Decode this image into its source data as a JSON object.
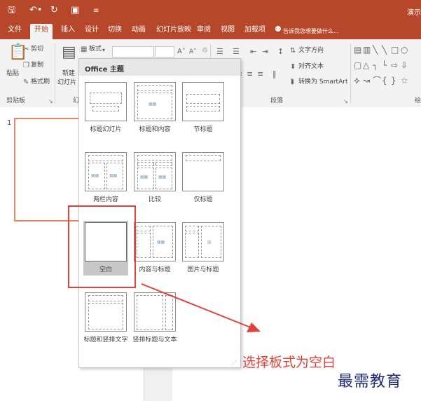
{
  "titlebar": {
    "save_icon": "save-icon",
    "undo_icon": "undo-icon",
    "redo_icon": "redo-icon",
    "start_icon": "start-from-beginning-icon",
    "customize_icon": "customize-toolbar-icon",
    "title_text": "演示"
  },
  "tabs": [
    {
      "label": "文件"
    },
    {
      "label": "开始"
    },
    {
      "label": "插入"
    },
    {
      "label": "设计"
    },
    {
      "label": "切换"
    },
    {
      "label": "动画"
    },
    {
      "label": "幻灯片放映"
    },
    {
      "label": "审阅"
    },
    {
      "label": "视图"
    },
    {
      "label": "加载项"
    }
  ],
  "tellme": "告诉我您想要做什么...",
  "ribbon": {
    "paste": "粘贴",
    "cut": "剪切",
    "copy": "复制",
    "format_painter": "格式刷",
    "clipboard": "剪贴板",
    "new_slide_1": "新建",
    "new_slide_2": "幻灯片",
    "layout": "板式",
    "text_direction": "文字方向",
    "align_text": "对齐文本",
    "smartart": "转换为 SmartArt",
    "paragraph": "段落",
    "slides_group_partial": "幻",
    "drawing_partial": "绘"
  },
  "slide_number": "1",
  "layout_panel": {
    "title": "Office 主题",
    "layouts": [
      {
        "label": "标题幻灯片"
      },
      {
        "label": "标题和内容"
      },
      {
        "label": "节标题"
      },
      {
        "label": "两栏内容"
      },
      {
        "label": "比较"
      },
      {
        "label": "仅标题"
      },
      {
        "label": "空白"
      },
      {
        "label": "内容与标题"
      },
      {
        "label": "图片与标题"
      },
      {
        "label": "标题和竖排文字"
      },
      {
        "label": "竖排标题与文本"
      }
    ],
    "selected": "空白"
  },
  "annotation": {
    "text": "选择板式为空白",
    "color": "#e0413a"
  },
  "watermark": {
    "text": "最需教育",
    "color": "#1f2b7a"
  },
  "colors": {
    "accent": "#b7472a",
    "ribbon_bg": "#f3f3f3",
    "highlight_box": "#e0413a"
  }
}
